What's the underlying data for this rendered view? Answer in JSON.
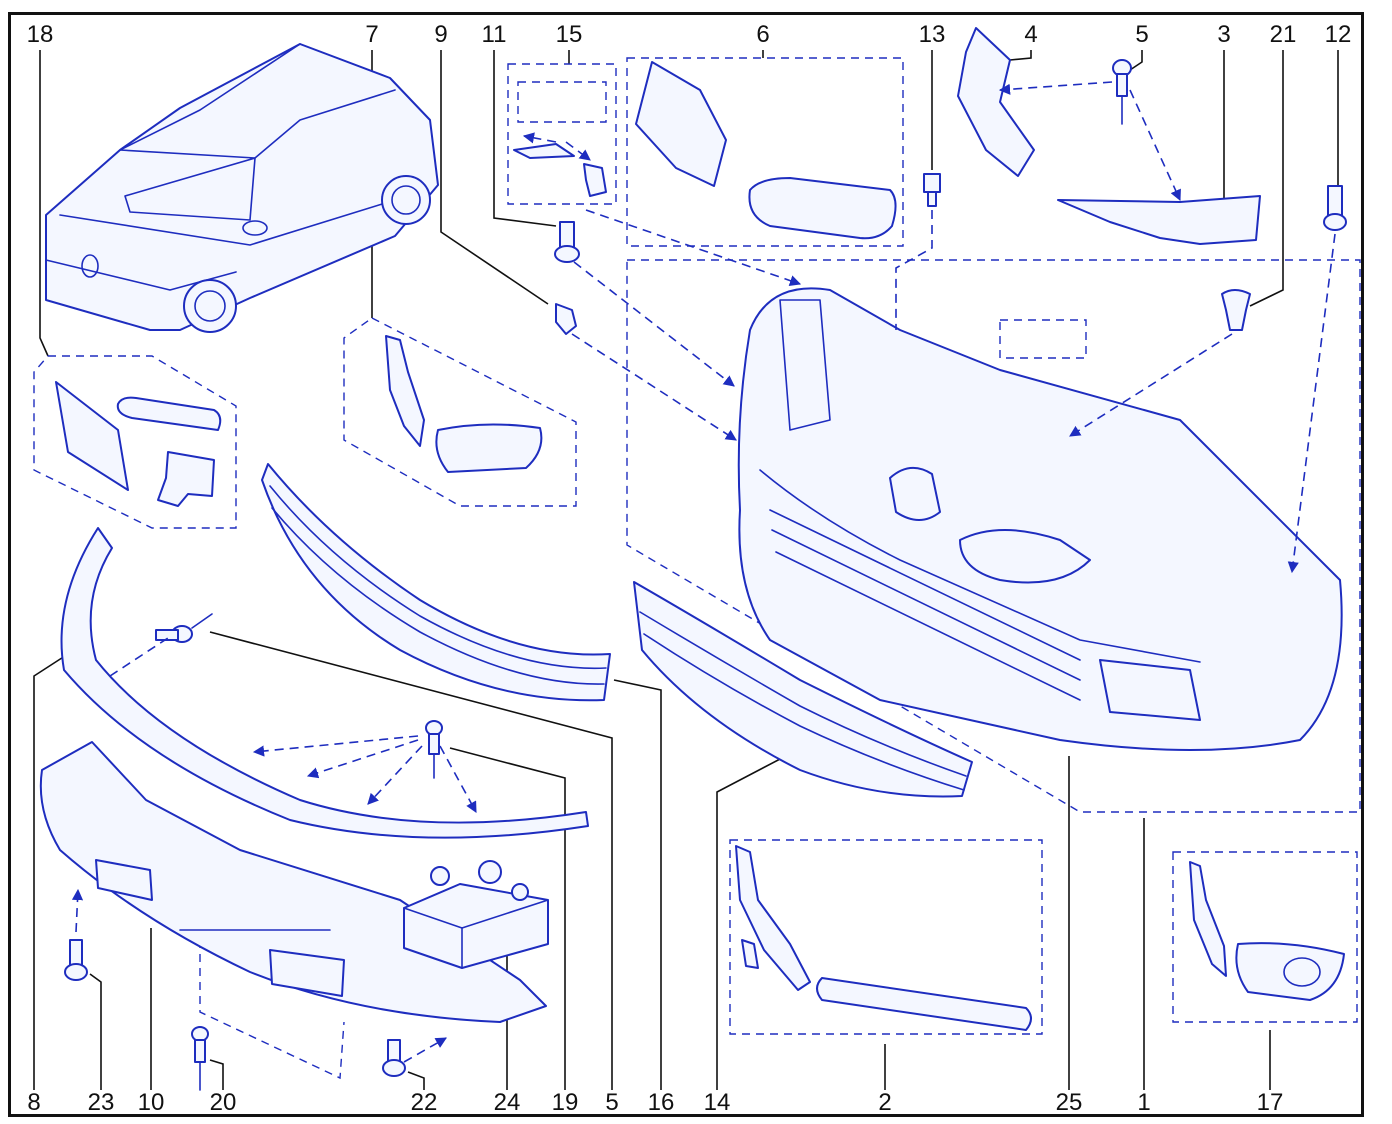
{
  "diagram": {
    "accent_color": "#1e2dbf",
    "line_color": "#111111",
    "callouts": {
      "n1": "1",
      "n2": "2",
      "n3": "3",
      "n4": "4",
      "n5a": "5",
      "n5b": "5",
      "n6": "6",
      "n7": "7",
      "n8": "8",
      "n9": "9",
      "n10": "10",
      "n11": "11",
      "n12": "12",
      "n13": "13",
      "n14": "14",
      "n15": "15",
      "n16": "16",
      "n17": "17",
      "n18": "18",
      "n19": "19",
      "n20": "20",
      "n21": "21",
      "n22": "22",
      "n23": "23",
      "n24": "24",
      "n25": "25"
    }
  }
}
